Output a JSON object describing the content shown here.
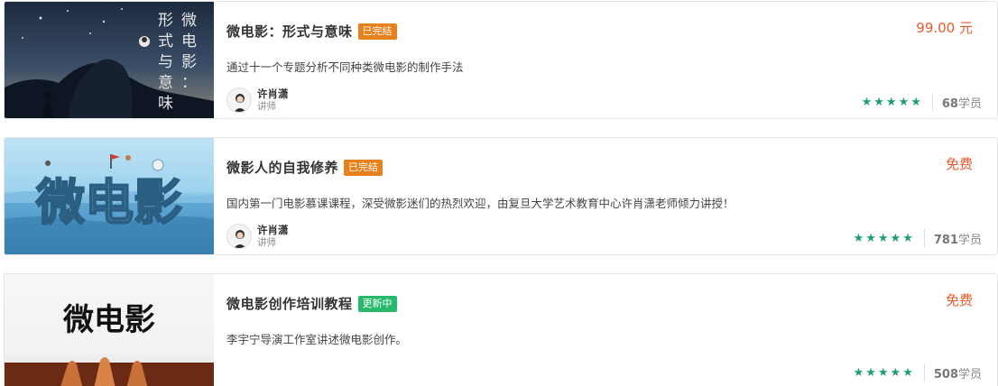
{
  "courses": [
    {
      "title": "微电影：形式与意味",
      "badge": "已完结",
      "badge_type": "done",
      "description": "通过十一个专题分析不同种类微电影的制作手法",
      "teacher": {
        "name": "许肖潇",
        "role": "讲师"
      },
      "price": "99.00 元",
      "rating": 5,
      "students_count": "68",
      "students_unit": "学员",
      "thumb_text": [
        "微",
        "电",
        "影",
        "：",
        "形",
        "式",
        "与",
        "意",
        "味"
      ]
    },
    {
      "title": "微影人的自我修养",
      "badge": "已完结",
      "badge_type": "done",
      "description": "国内第一门电影慕课课程，深受微影迷们的热烈欢迎，由复旦大学艺术教育中心许肖潇老师倾力讲授！",
      "teacher": {
        "name": "许肖潇",
        "role": "讲师"
      },
      "price": "免费",
      "rating": 5,
      "students_count": "781",
      "students_unit": "学员",
      "thumb_text": [
        "微电影"
      ]
    },
    {
      "title": "微电影创作培训教程",
      "badge": "更新中",
      "badge_type": "new",
      "description": "李宇宁导演工作室讲述微电影创作。",
      "price": "免费",
      "rating": 5,
      "students_count": "508",
      "students_unit": "学员",
      "thumb_text": [
        "微电影"
      ]
    }
  ],
  "colors": {
    "price": "#e85a2a",
    "badge_done": "#e8801c",
    "badge_new": "#27b96b",
    "star": "#1f9e6e"
  },
  "icons": {
    "star": "star-icon",
    "avatar": "teacher-avatar-icon"
  }
}
